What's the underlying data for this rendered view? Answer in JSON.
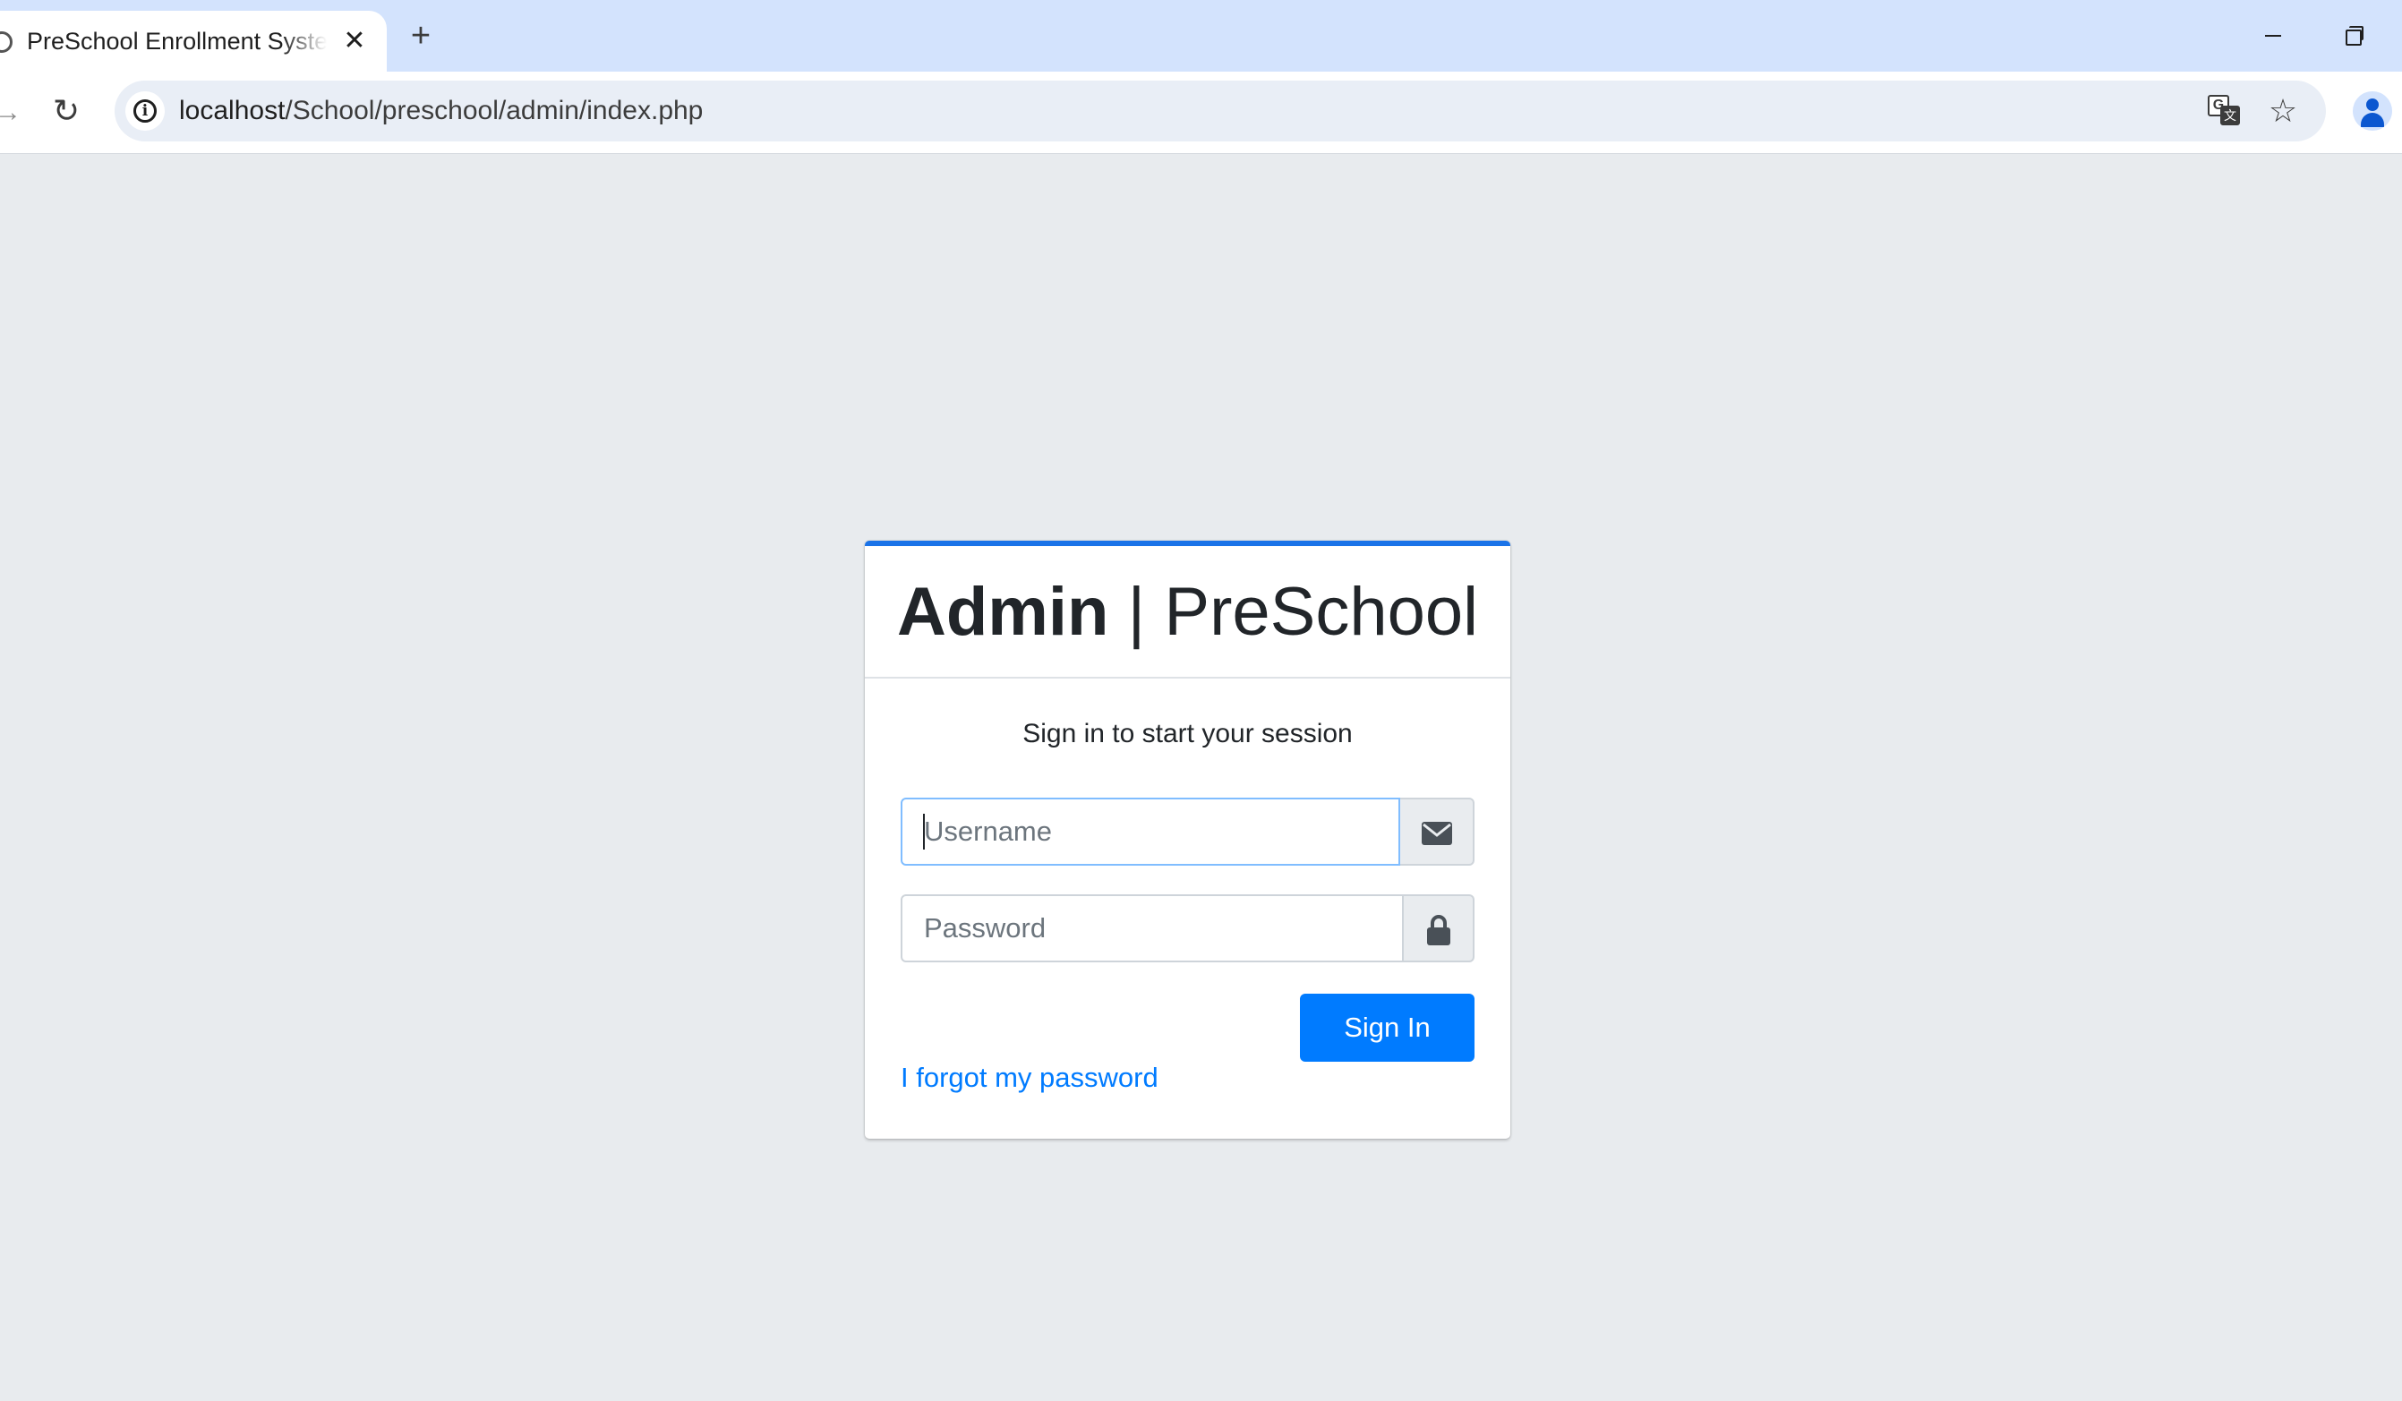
{
  "browser": {
    "tab_title": "PreSchool Enrollment System",
    "tab_close": "✕",
    "new_tab": "+",
    "url_host": "localhost",
    "url_path": "/School/preschool/admin/index.php",
    "icons": {
      "favicon": "site-favicon-icon",
      "close": "close-icon",
      "new_tab": "plus-icon",
      "forward": "forward-arrow-icon",
      "reload": "reload-icon",
      "site_info": "info-icon",
      "translate": "translate-icon",
      "bookmark": "star-icon",
      "profile": "profile-avatar-icon",
      "minimize": "minimize-icon",
      "restore": "restore-icon"
    }
  },
  "login": {
    "brand_bold": "Admin",
    "brand_separator": "|",
    "brand_light": "PreSchool",
    "message": "Sign in to start your session",
    "username_placeholder": "Username",
    "username_value": "",
    "password_placeholder": "Password",
    "password_value": "",
    "signin_label": "Sign In",
    "forgot_label": "I forgot my password",
    "icons": {
      "username_addon": "envelope-icon",
      "password_addon": "lock-icon"
    }
  },
  "colors": {
    "primary": "#007bff",
    "card_accent": "#1a73e8",
    "page_background": "#e8ebee",
    "tabstrip_background": "#d3e3fd"
  }
}
